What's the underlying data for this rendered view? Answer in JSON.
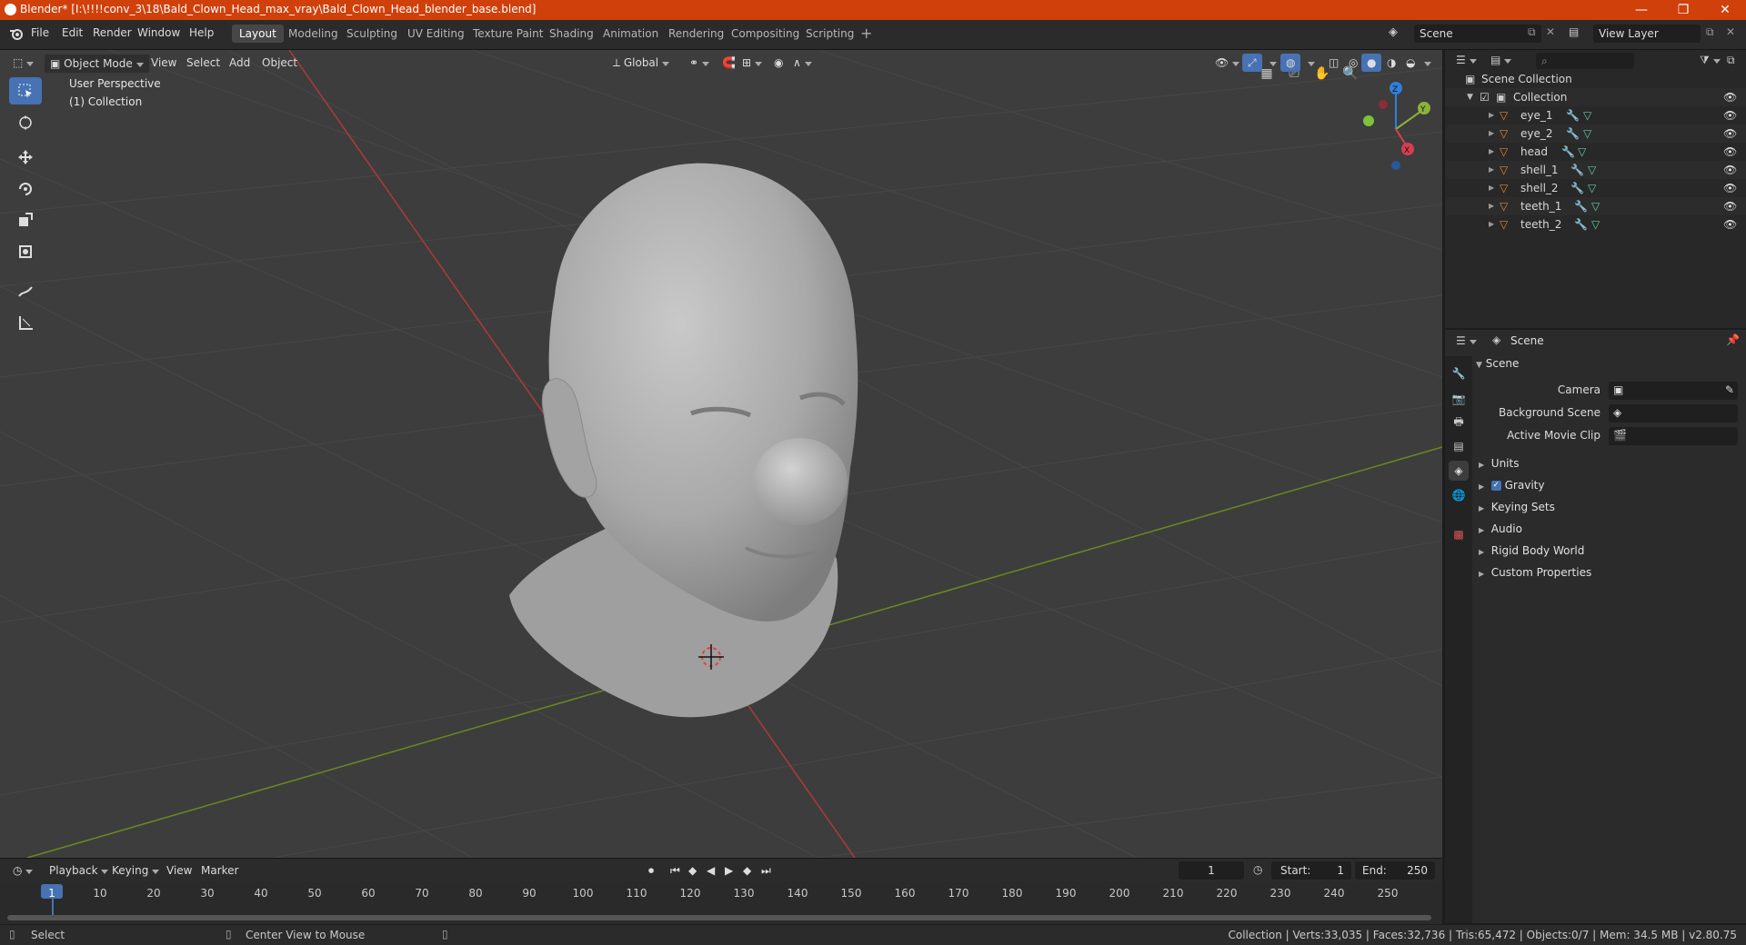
{
  "window": {
    "title": "Blender* [I:\\!!!!conv_3\\18\\Bald_Clown_Head_max_vray\\Bald_Clown_Head_blender_base.blend]",
    "minimize": "—",
    "maximize": "❐",
    "close": "✕"
  },
  "menu": {
    "file": "File",
    "edit": "Edit",
    "render": "Render",
    "window": "Window",
    "help": "Help"
  },
  "workspaces": [
    "Layout",
    "Modeling",
    "Sculpting",
    "UV Editing",
    "Texture Paint",
    "Shading",
    "Animation",
    "Rendering",
    "Compositing",
    "Scripting"
  ],
  "scene_field": "Scene",
  "view_layer_field": "View Layer",
  "viewport_header": {
    "mode": "Object Mode",
    "view": "View",
    "select": "Select",
    "add": "Add",
    "object": "Object",
    "orientation": "Global"
  },
  "viewport": {
    "perspective_label": "User Perspective",
    "collection_label": "(1) Collection",
    "gizmo": {
      "x": "X",
      "y": "Y",
      "z": "Z"
    }
  },
  "outliner": {
    "root": "Scene Collection",
    "collection": "Collection",
    "objects": [
      "eye_1",
      "eye_2",
      "head",
      "shell_1",
      "shell_2",
      "teeth_1",
      "teeth_2"
    ]
  },
  "properties": {
    "header": "Scene",
    "section": "Scene",
    "camera_label": "Camera",
    "background_scene_label": "Background Scene",
    "active_movie_clip_label": "Active Movie Clip",
    "panels": {
      "units": "Units",
      "gravity": "Gravity",
      "keying_sets": "Keying Sets",
      "audio": "Audio",
      "rigid_body_world": "Rigid Body World",
      "custom_properties": "Custom Properties"
    },
    "gravity_checked": true
  },
  "timeline": {
    "playback": "Playback",
    "keying": "Keying",
    "view": "View",
    "marker": "Marker",
    "current_frame": "1",
    "start_label": "Start:",
    "start": "1",
    "end_label": "End:",
    "end": "250",
    "ruler": [
      "1",
      "10",
      "20",
      "30",
      "40",
      "50",
      "60",
      "70",
      "80",
      "90",
      "100",
      "110",
      "120",
      "130",
      "140",
      "150",
      "160",
      "170",
      "180",
      "190",
      "200",
      "210",
      "220",
      "230",
      "240",
      "250"
    ]
  },
  "status": {
    "select": "Select",
    "center_view": "Center View to Mouse",
    "stats": "Collection | Verts:33,035 | Faces:32,736 | Tris:65,472 | Objects:0/7 | Mem: 34.5 MB | v2.80.75"
  },
  "colors": {
    "title_bar": "#d0400b",
    "accent_blue": "#4772b3",
    "frame_current": "#4772b3",
    "axis_x": "#ad3b3b",
    "axis_y": "#6a8a1f",
    "mesh_orange": "#e8862c"
  }
}
